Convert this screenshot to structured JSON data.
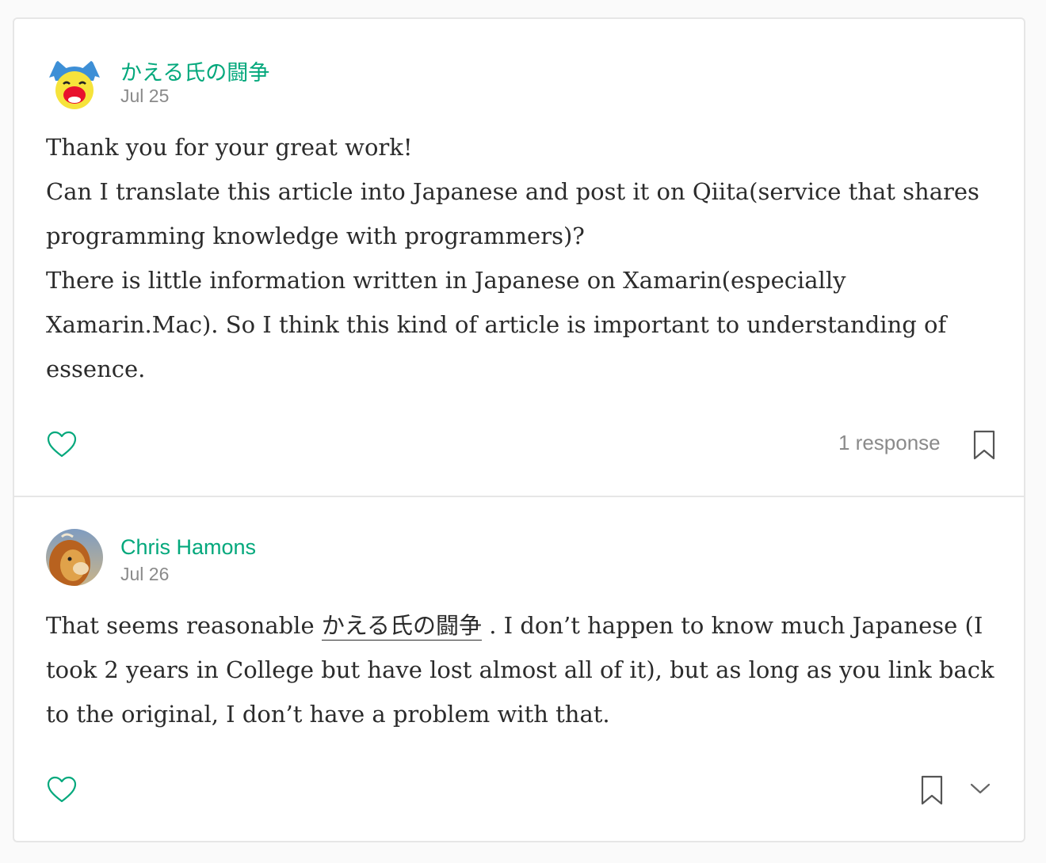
{
  "comments": [
    {
      "author": "かえる氏の闘争",
      "date": "Jul 25",
      "lines": [
        "Thank you for your great work!",
        "Can I translate this article into Japanese and post it on Qiita(service that shares programming knowledge with programmers)?",
        "There is little information written in Japanese on Xamarin(especially Xamarin.Mac). So I think this kind of article is important to understanding of essence."
      ],
      "responses_label": "1 response",
      "icons": [
        "heart-icon",
        "bookmark-icon"
      ]
    },
    {
      "author": "Chris Hamons",
      "date": "Jul 26",
      "text_before": "That seems reasonable ",
      "mention": "かえる氏の闘争",
      "text_after": " . I don’t happen to know much Japanese (I took 2 years in College but have lost almost all of it), but as long as you link back to the original, I don’t have a problem with that.",
      "icons": [
        "heart-icon",
        "bookmark-icon",
        "chevron-down-icon"
      ]
    }
  ],
  "colors": {
    "accent": "#03a87c",
    "text": "#2b2b2b",
    "muted": "#8a8a8a",
    "border": "#e6e6e6",
    "background": "#fafafa"
  }
}
